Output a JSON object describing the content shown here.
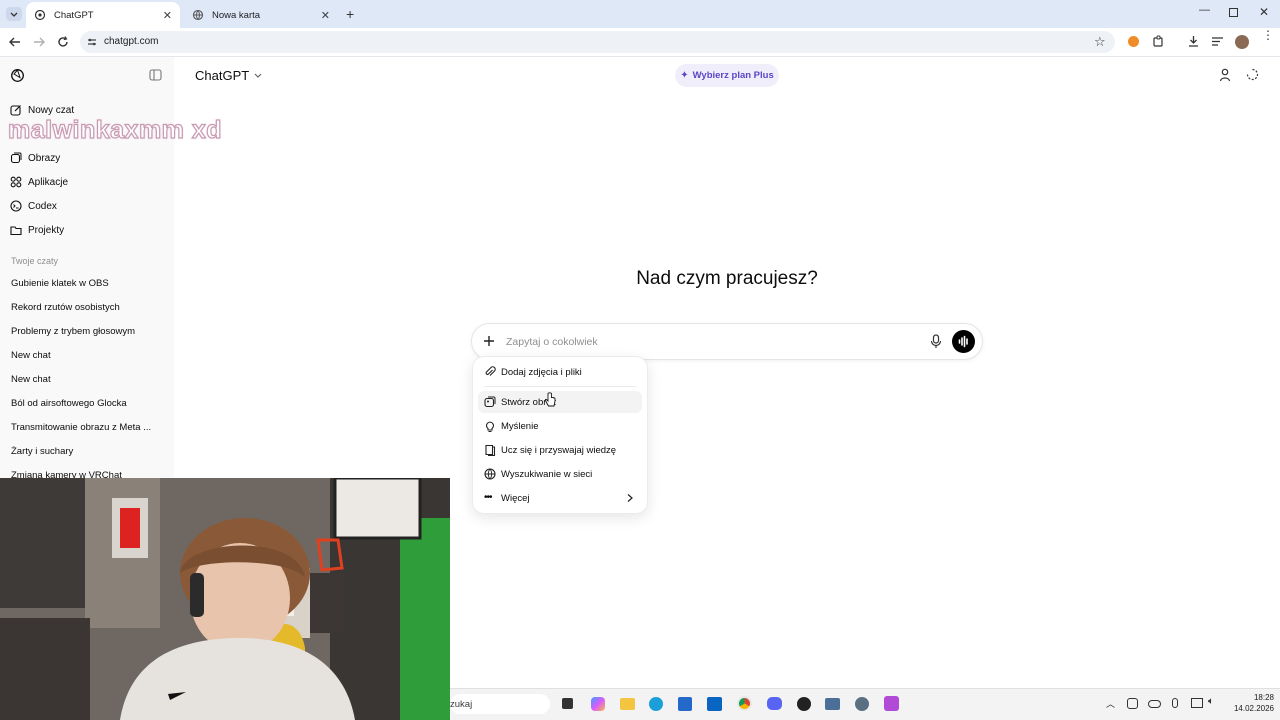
{
  "browser": {
    "tabs": [
      {
        "title": "ChatGPT",
        "active": true
      },
      {
        "title": "Nowa karta",
        "active": false
      }
    ],
    "url": "chatgpt.com"
  },
  "sidebar": {
    "nav": [
      {
        "label": "Nowy czat",
        "icon": "edit-icon"
      },
      {
        "label": "Obrazy",
        "icon": "images-icon"
      },
      {
        "label": "Aplikacje",
        "icon": "apps-icon"
      },
      {
        "label": "Codex",
        "icon": "codex-icon"
      },
      {
        "label": "Projekty",
        "icon": "folder-icon"
      }
    ],
    "section_label": "Twoje czaty",
    "chats": [
      "Gubienie klatek w OBS",
      "Rekord rzutów osobistych",
      "Problemy z trybem głosowym",
      "New chat",
      "New chat",
      "Ból od airsoftowego Glocka",
      "Transmitowanie obrazu z Meta ...",
      "Żarty i suchary",
      "Zmiana kamery w VRChat"
    ]
  },
  "overlay_text": "malwinkaxmm  xd",
  "header": {
    "model": "ChatGPT",
    "plus_button": "Wybierz plan Plus"
  },
  "main": {
    "headline": "Nad czym pracujesz?",
    "placeholder": "Zapytaj o cokolwiek"
  },
  "menu": {
    "items": [
      {
        "label": "Dodaj zdjęcia i pliki",
        "icon": "paperclip-icon"
      },
      {
        "label": "Stwórz obraz",
        "icon": "image-create-icon"
      },
      {
        "label": "Myślenie",
        "icon": "lightbulb-icon"
      },
      {
        "label": "Ucz się i przyswajaj wiedzę",
        "icon": "book-icon"
      },
      {
        "label": "Wyszukiwanie w sieci",
        "icon": "globe-icon"
      },
      {
        "label": "Więcej",
        "icon": "more-icon"
      }
    ]
  },
  "taskbar": {
    "search_text": "zukaj",
    "time": "18:28",
    "date": "14.02.2026"
  },
  "colors": {
    "accent_plus": "#5b45c6",
    "tabbar_bg": "#dfe8f7",
    "sidebar_bg": "#f9f9f9"
  }
}
